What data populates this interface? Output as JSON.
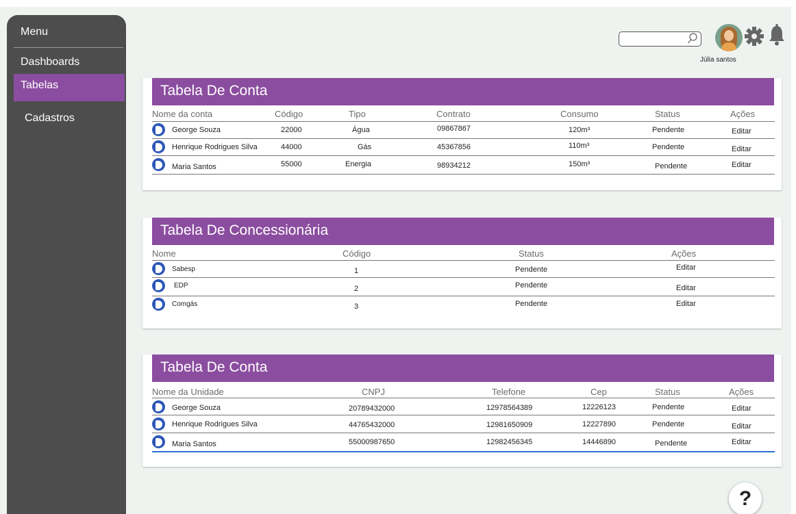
{
  "sidebar": {
    "title": "Menu",
    "items": [
      {
        "label": "Dashboards"
      },
      {
        "label": "Tabelas"
      },
      {
        "label": "Cadastros"
      }
    ]
  },
  "header": {
    "search_placeholder": "",
    "user_name": "Júlia santos"
  },
  "table1": {
    "title": "Tabela De Conta",
    "columns": [
      "Nome da conta",
      "Código",
      "Tipo",
      "Contrato",
      "Consumo",
      "Status",
      "Ações"
    ],
    "rows": [
      {
        "name": "George Souza",
        "code": "22000",
        "type": "Água",
        "contract": "09867867",
        "consumption": "120m³",
        "status": "Pendente",
        "action": "Editar"
      },
      {
        "name": "Henrique Rodrigues Silva",
        "code": "44000",
        "type": "Gás",
        "contract": "45367856",
        "consumption": "110m³",
        "status": "Pendente",
        "action": "Editar"
      },
      {
        "name": "Maria Santos",
        "code": "55000",
        "type": "Energia",
        "contract": "98934212",
        "consumption": "150m³",
        "status": "Pendente",
        "action": "Editar"
      }
    ]
  },
  "table2": {
    "title": "Tabela De Concessionária",
    "columns": [
      "Nome",
      "Código",
      "Status",
      "Ações"
    ],
    "rows": [
      {
        "name": "Sabesp",
        "code": "1",
        "status": "Pendente",
        "action": "Editar"
      },
      {
        "name": "EDP",
        "code": "2",
        "status": "Pendente",
        "action": "Editar"
      },
      {
        "name": "Comgás",
        "code": "3",
        "status": "Pendente",
        "action": "Editar"
      }
    ]
  },
  "table3": {
    "title": "Tabela De Conta",
    "columns": [
      "Nome da Unidade",
      "CNPJ",
      "Telefone",
      "Cep",
      "Status",
      "Ações"
    ],
    "rows": [
      {
        "name": "George Souza",
        "cnpj": "20789432000",
        "phone": "12978564389",
        "cep": "12226123",
        "status": "Pendente",
        "action": "Editar"
      },
      {
        "name": "Henrique Rodrigues Silva",
        "cnpj": "44765432000",
        "phone": "12981650909",
        "cep": "12227890",
        "status": "Pendente",
        "action": "Editar"
      },
      {
        "name": "Maria Santos",
        "cnpj": "55000987650",
        "phone": "12982456345",
        "cep": "14446890",
        "status": "Pendente",
        "action": "Editar"
      }
    ]
  },
  "help_label": "?",
  "colors": {
    "accent": "#8b4d9f",
    "sidebar": "#4d4d4d",
    "icon": "#2d57b8"
  },
  "icons": {
    "search": "search-icon",
    "gear": "gear-icon",
    "bell": "bell-icon",
    "help": "help-icon",
    "row": "account-icon"
  }
}
